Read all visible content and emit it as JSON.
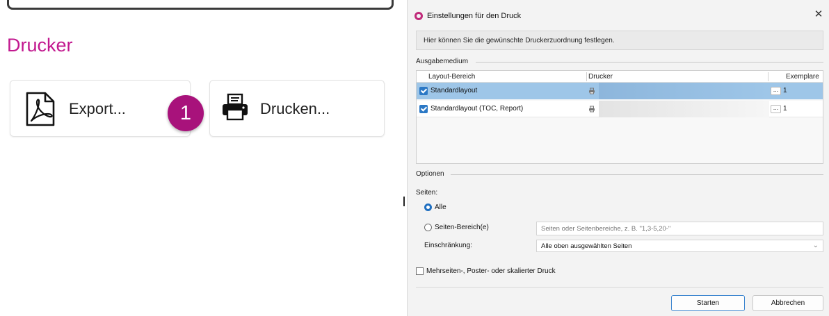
{
  "left": {
    "section_title": "Drucker",
    "export_label": "Export...",
    "print_label": "Drucken...",
    "step_badge": "1",
    "icons": {
      "export": "pdf-icon",
      "print": "printer-icon"
    },
    "accent_color": "#c2188f",
    "badge_color": "#a8127b"
  },
  "dialog": {
    "title": "Einstellungen für den Druck",
    "close_glyph": "✕",
    "info": "Hier können Sie die gewünschte Druckerzuordnung festlegen.",
    "output_group": "Ausgabemedium",
    "columns": {
      "layout": "Layout-Bereich",
      "printer": "Drucker",
      "copies": "Exemplare"
    },
    "rows": [
      {
        "name": "Standardlayout",
        "checked": true,
        "selected": true,
        "dots": "...",
        "copies": "1"
      },
      {
        "name": "Standardlayout (TOC, Report)",
        "checked": true,
        "selected": false,
        "dots": "...",
        "copies": "1"
      }
    ],
    "options_group": "Optionen",
    "pages_label": "Seiten:",
    "radio_all": "Alle",
    "radio_range": "Seiten-Bereich(e)",
    "range_placeholder": "Seiten oder Seitenbereiche, z. B. \"1,3-5,20-\"",
    "restriction_label": "Einschränkung:",
    "restriction_value": "Alle oben ausgewählten Seiten",
    "multipage_label": "Mehrseiten-, Poster- oder skalierter Druck",
    "start_button": "Starten",
    "cancel_button": "Abbrechen",
    "selection_color": "#9ec6e8"
  }
}
